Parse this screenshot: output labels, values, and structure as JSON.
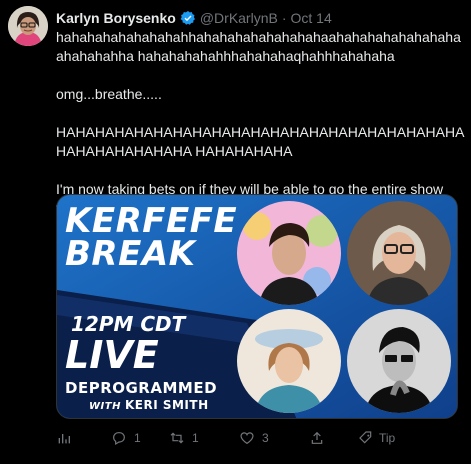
{
  "tweet": {
    "author_name": "Karlyn Borysenko",
    "handle": "@DrKarlynB",
    "separator": "·",
    "date": "Oct 14",
    "paragraphs": [
      "hahahahahahahahahhahahahahahahahahaahahahahahahahahaahahahahha hahahahahahhhahahahaqhahhhahahaha",
      "omg...breathe.....",
      "HAHAHAHAHAHAHAHAHAHAHAHAHAHAHAHAHAHAHAHAHAHAHAHAHAHAHAHA HAHAHAHAHA",
      "I'm now taking bets on if they will be able to go the entire show without talking about me."
    ]
  },
  "media": {
    "title_line1": "KERFEFE",
    "title_line2": "BREAK",
    "time": "12PM CDT",
    "live": "LIVE",
    "show": "DEPROGRAMMED",
    "with": "WITH",
    "host": "KERI SMITH"
  },
  "actions": {
    "reply_count": "1",
    "retweet_count": "1",
    "like_count": "3",
    "tip_label": "Tip"
  },
  "colors": {
    "background": "#000000",
    "text_primary": "#e7e9ea",
    "text_secondary": "#71767b",
    "verified": "#1d9bf0",
    "media_blue": "#1a5fb3"
  },
  "icons": [
    "analytics-icon",
    "reply-icon",
    "retweet-icon",
    "like-icon",
    "share-icon",
    "tip-icon",
    "verified-badge-icon"
  ]
}
